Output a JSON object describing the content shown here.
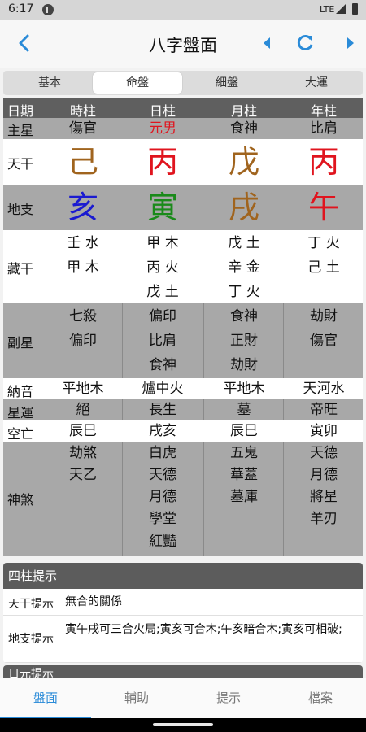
{
  "status": {
    "time": "6:17",
    "network": "LTE"
  },
  "appbar": {
    "title": "八字盤面"
  },
  "tabs": [
    "基本",
    "命盤",
    "細盤",
    "大運"
  ],
  "chart": {
    "header": {
      "label": "日期",
      "cols": [
        "時柱",
        "日柱",
        "月柱",
        "年柱"
      ]
    },
    "main_star": {
      "label": "主星",
      "cols": [
        "傷官",
        "元男",
        "食神",
        "比肩"
      ]
    },
    "heavenly": {
      "label": "天干",
      "cols": [
        "己",
        "丙",
        "戊",
        "丙"
      ]
    },
    "earthly": {
      "label": "地支",
      "cols": [
        "亥",
        "寅",
        "戌",
        "午"
      ]
    },
    "hidden": {
      "label": "藏干",
      "cols": [
        [
          "壬 水",
          "甲 木"
        ],
        [
          "甲 木",
          "丙 火",
          "戊 土"
        ],
        [
          "戊 土",
          "辛 金",
          "丁 火"
        ],
        [
          "丁 火",
          "己 土"
        ]
      ]
    },
    "secondary": {
      "label": "副星",
      "cols": [
        [
          "七殺",
          "偏印"
        ],
        [
          "偏印",
          "比肩",
          "食神"
        ],
        [
          "食神",
          "正財",
          "劫財"
        ],
        [
          "劫財",
          "傷官"
        ]
      ]
    },
    "nayin": {
      "label": "納音",
      "cols": [
        "平地木",
        "爐中火",
        "平地木",
        "天河水"
      ]
    },
    "star_luck": {
      "label": "星運",
      "cols": [
        "絕",
        "長生",
        "墓",
        "帝旺"
      ]
    },
    "void": {
      "label": "空亡",
      "cols": [
        "辰巳",
        "戌亥",
        "辰巳",
        "寅卯"
      ]
    },
    "spirits": {
      "label": "神煞",
      "cols": [
        [
          "劫煞",
          "天乙"
        ],
        [
          "白虎",
          "天德",
          "月德",
          "學堂",
          "紅豔"
        ],
        [
          "五鬼",
          "華蓋",
          "墓庫"
        ],
        [
          "天德",
          "月德",
          "將星",
          "羊刃"
        ]
      ]
    }
  },
  "colors": {
    "earth": "#a0641e",
    "fire": "#e0141e",
    "water": "#1a1ad0",
    "wood": "#1a8a1a",
    "accent": "#2a8bd8"
  },
  "hints": {
    "title": "四柱提示",
    "rows": [
      {
        "label": "天干提示",
        "text": "無合的關係"
      },
      {
        "label": "地支提示",
        "text": "寅午戌可三合火局;寅亥可合木;午亥暗合木;寅亥可相破;"
      }
    ],
    "next_title": "日元提示"
  },
  "bottom_nav": [
    "盤面",
    "輔助",
    "提示",
    "檔案"
  ]
}
